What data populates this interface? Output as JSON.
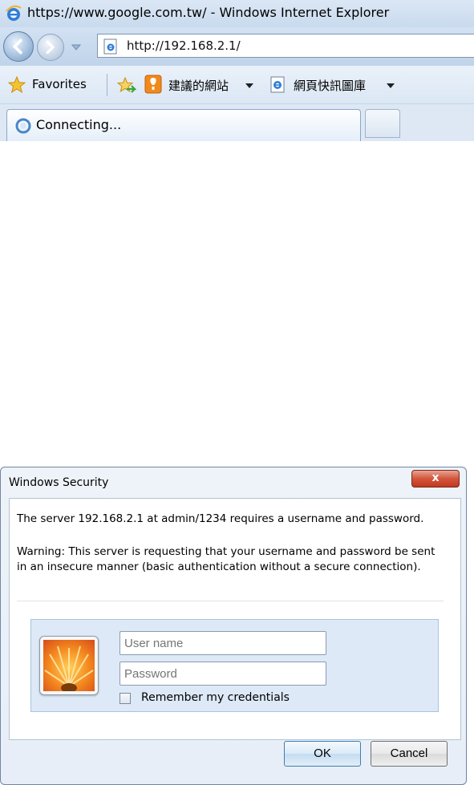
{
  "window": {
    "title": "https://www.google.com.tw/ - Windows Internet Explorer"
  },
  "address_bar": {
    "url": "http://192.168.2.1/"
  },
  "favorites_bar": {
    "favorites_label": "Favorites",
    "suggested_sites_label": "建議的網站",
    "web_slice_gallery_label": "網頁快訊圖庫"
  },
  "tabs": [
    {
      "label": "Connecting..."
    }
  ],
  "dialog": {
    "title": "Windows Security",
    "close_label": "x",
    "message": "The server 192.168.2.1 at admin/1234 requires a username and password.",
    "warning": "Warning: This server is requesting that your username and password be sent in an insecure manner (basic authentication without a secure connection).",
    "username_placeholder": "User name",
    "password_placeholder": "Password",
    "remember_label": "Remember my credentials",
    "ok_label": "OK",
    "cancel_label": "Cancel"
  },
  "colors": {
    "chrome": "#c9daee",
    "close_red": "#c2371d",
    "panel": "#dde9f7"
  }
}
